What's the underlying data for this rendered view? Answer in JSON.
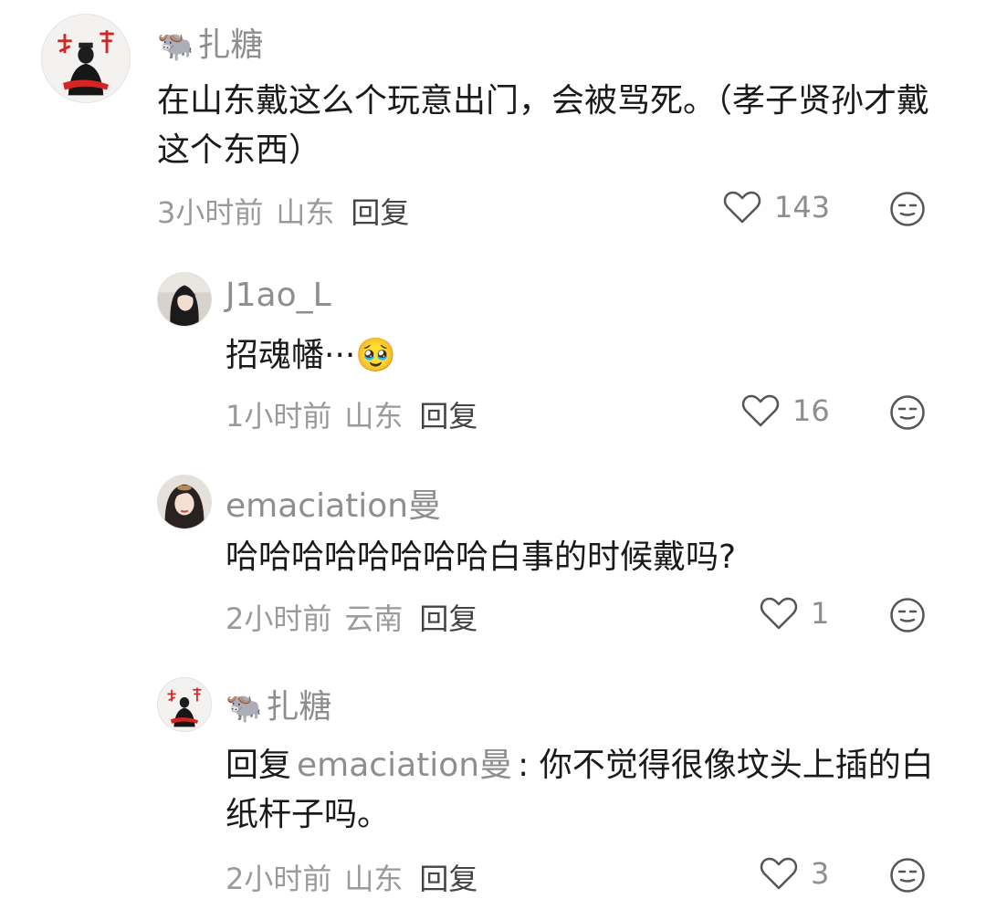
{
  "comments": [
    {
      "user": "扎糖",
      "user_emoji": "🐃",
      "text": "在山东戴这么个玩意出门，会被骂死。（孝子贤孙才戴这个东西）",
      "time": "3小时前",
      "location": "山东",
      "reply_label": "回复",
      "likes": "143"
    },
    {
      "user": "J1ao_L",
      "text": "招魂幡···🥹",
      "time": "1小时前",
      "location": "山东",
      "reply_label": "回复",
      "likes": "16"
    },
    {
      "user": "emaciation曼",
      "text": "哈哈哈哈哈哈哈哈白事的时候戴吗?",
      "time": "2小时前",
      "location": "云南",
      "reply_label": "回复",
      "likes": "1"
    },
    {
      "user": "扎糖",
      "user_emoji": "🐃",
      "reply_prefix": "回复",
      "reply_to": "emaciation曼",
      "reply_colon": ":",
      "text": "你不觉得很像坟头上插的白纸杆子吗。",
      "time": "2小时前",
      "location": "山东",
      "reply_label": "回复",
      "likes": "3"
    }
  ],
  "icons": {
    "like": "heart-outline-icon",
    "dislike": "neutral-face-icon"
  },
  "colors": {
    "text": "#1a1a1a",
    "meta": "#9a9a9a",
    "accent_red": "#d42424"
  }
}
